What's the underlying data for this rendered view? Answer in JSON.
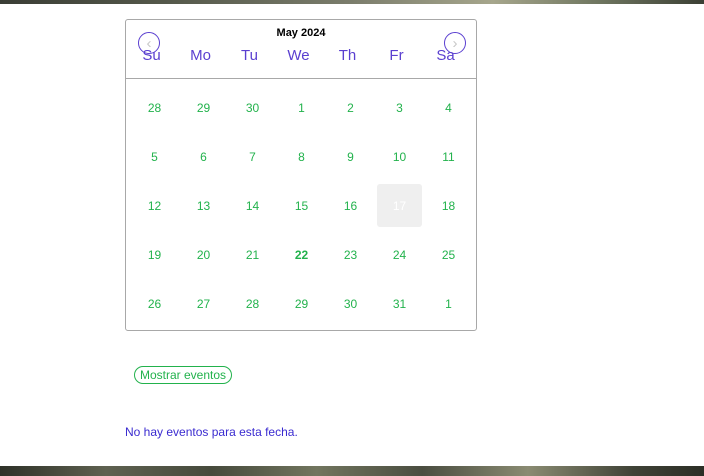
{
  "calendar": {
    "title": "May 2024",
    "prev_icon": "chevron-left-icon",
    "next_icon": "chevron-right-icon",
    "weekdays": [
      "Su",
      "Mo",
      "Tu",
      "We",
      "Th",
      "Fr",
      "Sa"
    ],
    "weeks": [
      [
        "28",
        "29",
        "30",
        "1",
        "2",
        "3",
        "4"
      ],
      [
        "5",
        "6",
        "7",
        "8",
        "9",
        "10",
        "11"
      ],
      [
        "12",
        "13",
        "14",
        "15",
        "16",
        "17",
        "18"
      ],
      [
        "19",
        "20",
        "21",
        "22",
        "23",
        "24",
        "25"
      ],
      [
        "26",
        "27",
        "28",
        "29",
        "30",
        "31",
        "1"
      ]
    ],
    "selected_day": "17",
    "today": "22"
  },
  "show_events_label": "Mostrar eventos",
  "no_events_text": "No hay eventos para esta fecha.",
  "colors": {
    "accent_purple": "#5a3fd0",
    "day_green": "#22b24c",
    "message_blue": "#3a2bd0"
  }
}
